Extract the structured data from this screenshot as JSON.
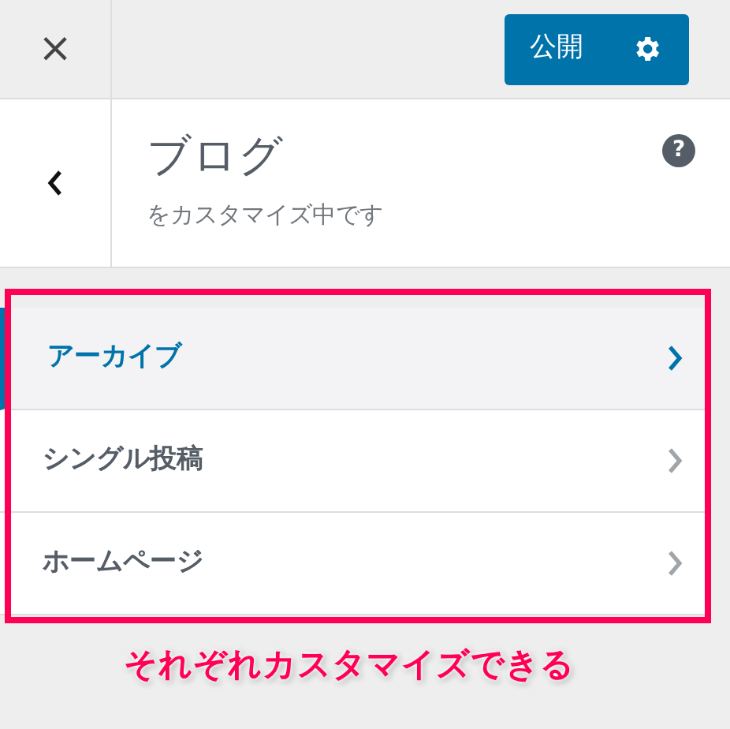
{
  "header": {
    "close": "×",
    "publish_button": "公開"
  },
  "section": {
    "title": "ブログ",
    "subtitle": "をカスタマイズ中です",
    "help": "?"
  },
  "items": [
    {
      "label": "アーカイブ",
      "selected": true
    },
    {
      "label": "シングル投稿",
      "selected": false
    },
    {
      "label": "ホームページ",
      "selected": false
    }
  ],
  "annotation": "それぞれカスタマイズできる"
}
